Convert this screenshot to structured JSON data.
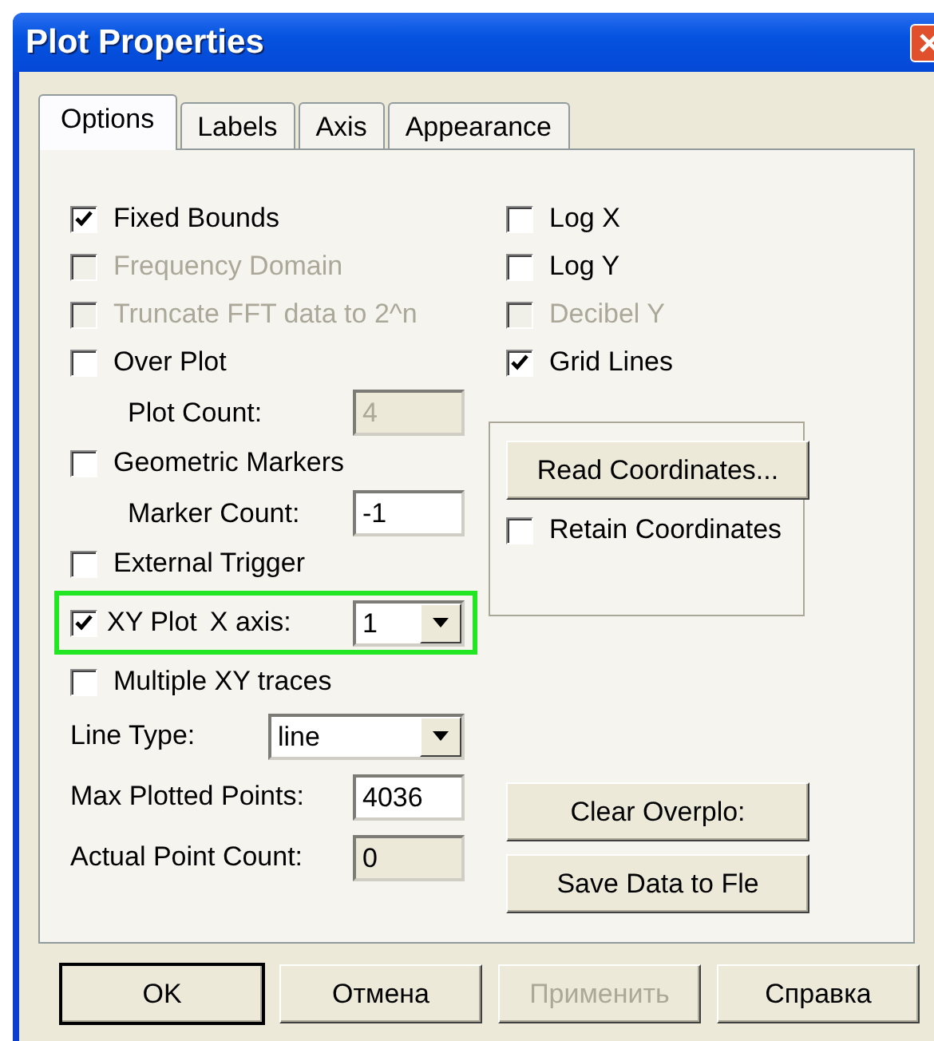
{
  "window": {
    "title": "Plot Properties"
  },
  "tabs": [
    {
      "label": "Options",
      "selected": true
    },
    {
      "label": "Labels",
      "selected": false
    },
    {
      "label": "Axis",
      "selected": false
    },
    {
      "label": "Appearance",
      "selected": false
    }
  ],
  "left_options": [
    {
      "kind": "checkbox",
      "label": "Fixed Bounds",
      "checked": true,
      "disabled": false
    },
    {
      "kind": "checkbox",
      "label": "Frequency Domain",
      "checked": false,
      "disabled": true
    },
    {
      "kind": "checkbox",
      "label": "Truncate FFT data to 2^n",
      "checked": false,
      "disabled": true
    },
    {
      "kind": "checkbox",
      "label": "Over Plot",
      "checked": false,
      "disabled": false
    },
    {
      "kind": "subfield",
      "label": "Plot Count:",
      "value": "4",
      "disabled": true
    },
    {
      "kind": "checkbox",
      "label": "Geometric Markers",
      "checked": false,
      "disabled": false
    },
    {
      "kind": "subfield",
      "label": "Marker Count:",
      "value": "-1",
      "disabled": false
    },
    {
      "kind": "checkbox",
      "label": "External Trigger",
      "checked": false,
      "disabled": false
    },
    {
      "kind": "checkbox_combo",
      "label": "XY Plot",
      "checked": true,
      "combo_label": "X axis:",
      "value": "1",
      "highlighted": true
    },
    {
      "kind": "checkbox",
      "label": "Multiple XY traces",
      "checked": false,
      "disabled": false
    },
    {
      "kind": "combo",
      "label": "Line Type:",
      "value": "line"
    },
    {
      "kind": "field",
      "label": "Max Plotted Points:",
      "value": "4036",
      "readonly": false
    },
    {
      "kind": "field",
      "label": "Actual Point Count:",
      "value": "0",
      "readonly": true
    }
  ],
  "right_options": [
    {
      "label": "Log X",
      "checked": false,
      "disabled": false
    },
    {
      "label": "Log Y",
      "checked": false,
      "disabled": false
    },
    {
      "label": "Decibel Y",
      "checked": false,
      "disabled": true
    },
    {
      "label": "Grid Lines",
      "checked": true,
      "disabled": false
    }
  ],
  "coordinates_group": {
    "button": "Read Coordinates...",
    "checkbox": {
      "label": "Retain Coordinates",
      "checked": false
    }
  },
  "action_buttons": [
    "Clear Overplo:",
    "Save Data to Fle"
  ],
  "dialog_buttons": [
    {
      "label": "OK",
      "default": true,
      "disabled": false
    },
    {
      "label": "Отмена",
      "default": false,
      "disabled": false
    },
    {
      "label": "Применить",
      "default": false,
      "disabled": true
    },
    {
      "label": "Справка",
      "default": false,
      "disabled": false
    }
  ]
}
